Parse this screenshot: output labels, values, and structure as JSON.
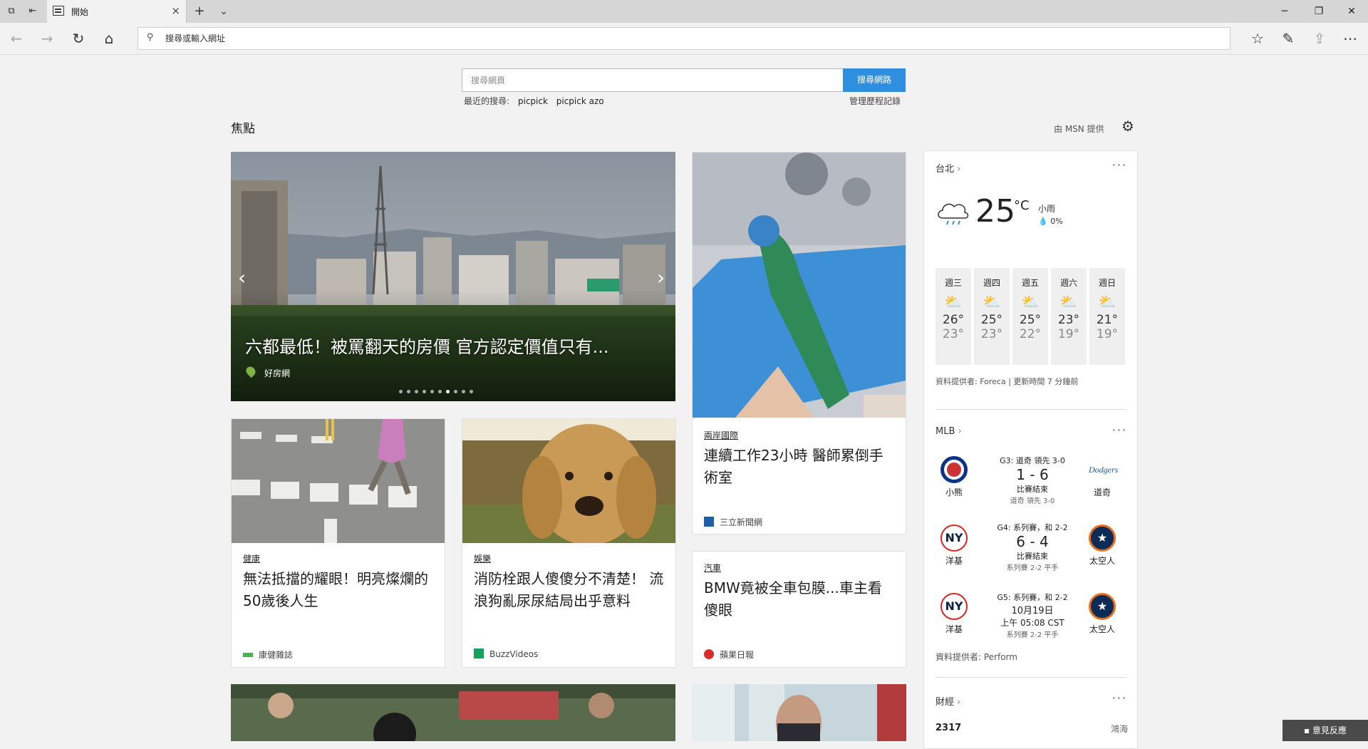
{
  "tab": {
    "label": "開始",
    "close": "×",
    "new": "+",
    "menu": "⌄"
  },
  "window": {
    "minimize": "─",
    "restore": "❐",
    "close": "✕"
  },
  "navbar": {
    "address_placeholder": "搜尋或輸入網址"
  },
  "search": {
    "placeholder": "搜尋網頁",
    "button": "搜尋網路",
    "recent_label": "最近的搜尋:",
    "recent": [
      "picpick",
      "picpick azo"
    ],
    "history": "管理歷程記錄"
  },
  "focus": {
    "title": "焦點",
    "provider": "由 MSN 提供"
  },
  "hero": {
    "caption": "六都最低！被罵翻天的房價 官方認定價值只有...",
    "source": "好房網",
    "slides": 10,
    "active_slide": 6
  },
  "cards": [
    {
      "category": "兩岸國際",
      "headline": "連續工作23小時 醫師累倒手術室",
      "source": "三立新聞網",
      "icon_color": "#1f5fa8"
    },
    {
      "category": "健康",
      "headline": "無法抵擋的耀眼！明亮燦爛的50歲後人生",
      "source": "康健雜誌",
      "icon_color": "#4caf50"
    },
    {
      "category": "娛樂",
      "headline": "消防栓跟人傻傻分不清楚！ 流浪狗亂尿尿結局出乎意料",
      "source": "BuzzVideos",
      "icon_color": "#16a05d"
    },
    {
      "category": "汽車",
      "headline": "BMW竟被全車包膜...車主看傻眼",
      "source": "蘋果日報",
      "icon_color": "#d32f2f"
    }
  ],
  "weather": {
    "location": "台北",
    "temp": "25",
    "unit": "°C",
    "condition": "小雨",
    "precip": "0%",
    "days": [
      {
        "day": "週三",
        "hi": "26°",
        "lo": "23°"
      },
      {
        "day": "週四",
        "hi": "25°",
        "lo": "23°"
      },
      {
        "day": "週五",
        "hi": "25°",
        "lo": "22°"
      },
      {
        "day": "週六",
        "hi": "23°",
        "lo": "19°"
      },
      {
        "day": "週日",
        "hi": "21°",
        "lo": "19°"
      }
    ],
    "credit": "資料提供者: Foreca | 更新時間 7 分鐘前"
  },
  "mlb": {
    "title": "MLB",
    "games": [
      {
        "status": "G3: 道奇 領先 3-0",
        "score": "1 - 6",
        "result": "比賽結束",
        "note": "道奇 領先 3-0",
        "home": "小熊",
        "away": "道奇"
      },
      {
        "status": "G4: 系列賽，和 2-2",
        "score": "6 - 4",
        "result": "比賽結束",
        "note": "系列賽 2-2 平手",
        "home": "洋基",
        "away": "太空人"
      },
      {
        "status": "G5: 系列賽，和 2-2",
        "score": "10月19日",
        "result": "上午 05:08 CST",
        "note": "系列賽 2-2 平手",
        "home": "洋基",
        "away": "太空人"
      }
    ],
    "credit": "資料提供者: Perform"
  },
  "finance": {
    "title": "財經",
    "value": "2317",
    "name": "鴻海"
  },
  "feedback": "意見反應"
}
